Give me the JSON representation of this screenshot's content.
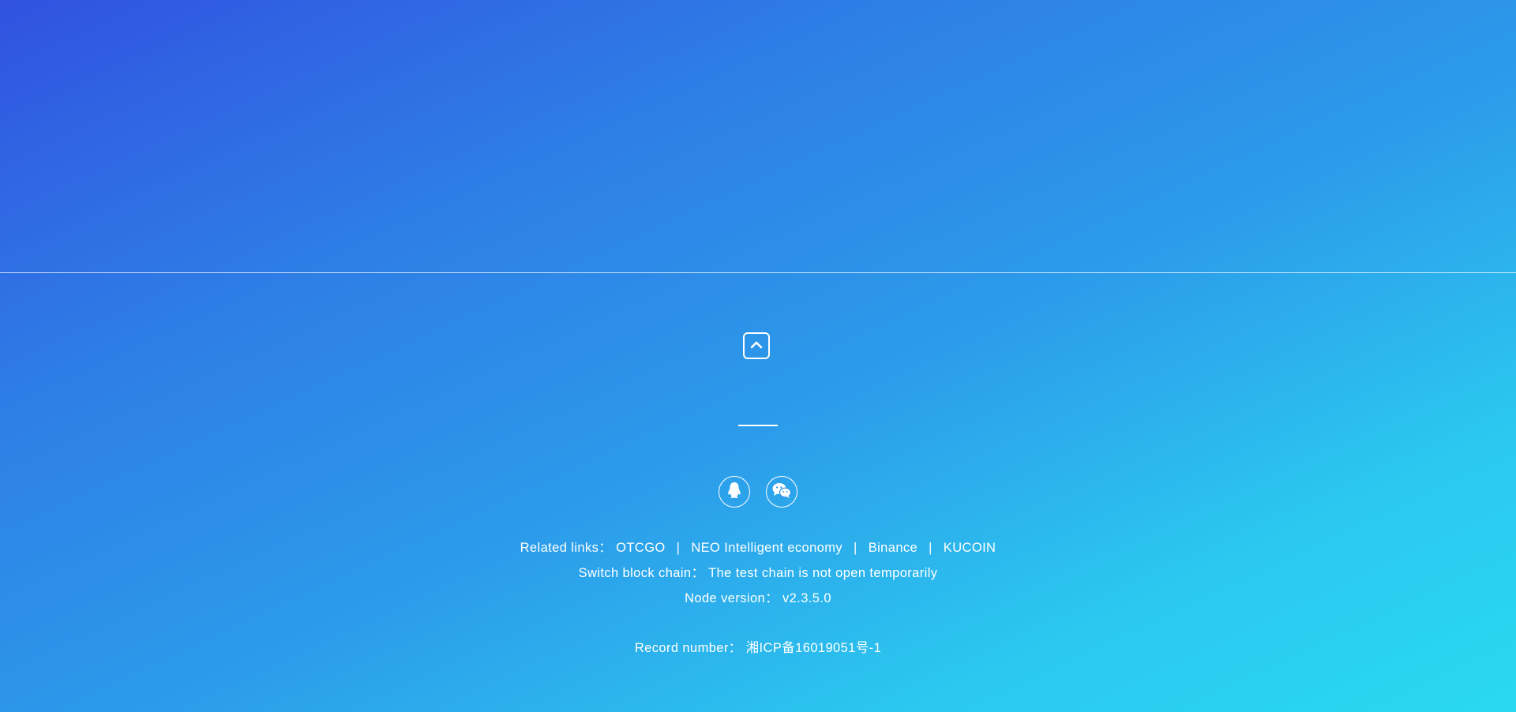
{
  "footer": {
    "back_to_top_icon": "chevron-up-icon",
    "social": [
      {
        "name": "qq",
        "icon": "qq-penguin-icon"
      },
      {
        "name": "wechat",
        "icon": "wechat-icon"
      }
    ],
    "related_links": {
      "label": "Related links：",
      "separator": "|",
      "links": [
        "OTCGO",
        "NEO Intelligent economy",
        "Binance",
        "KUCOIN"
      ]
    },
    "switch_chain": {
      "label": "Switch block chain：",
      "value": "The test chain is not open temporarily"
    },
    "node_version": {
      "label": "Node version：",
      "value": "v2.3.5.0"
    },
    "record_number": {
      "label": "Record number：",
      "value": "湘ICP备16019051号-1"
    }
  }
}
